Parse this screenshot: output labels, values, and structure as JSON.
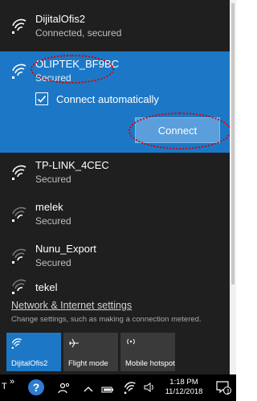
{
  "networks": [
    {
      "name": "DijitalOfis2",
      "status": "Connected, secured"
    },
    {
      "name": "OLIPTEK_BF9BC",
      "status": "Secured"
    },
    {
      "name": "TP-LINK_4CEC",
      "status": "Secured"
    },
    {
      "name": "melek",
      "status": "Secured"
    },
    {
      "name": "Nunu_Export",
      "status": "Secured"
    },
    {
      "name": "tekel",
      "status": ""
    }
  ],
  "selected": {
    "connect_automatically_label": "Connect automatically",
    "connect_automatically_checked": true,
    "connect_button_label": "Connect"
  },
  "settings": {
    "link_label": "Network & Internet settings",
    "description": "Change settings, such as making a connection metered."
  },
  "quick_actions": [
    {
      "label": "DijitalOfis2",
      "icon": "wifi-icon",
      "active": true
    },
    {
      "label": "Flight mode",
      "icon": "airplane-icon",
      "active": false
    },
    {
      "label": "Mobile hotspot",
      "icon": "hotspot-icon",
      "active": false
    }
  ],
  "taskbar": {
    "left_glyph": "T",
    "chevron_glyph": "»",
    "time": "1:18 PM",
    "date": "11/12/2018",
    "notification_count": "1"
  },
  "colors": {
    "flyout_bg": "#1f1f1f",
    "accent": "#1c78c6",
    "annotation": "#d50000"
  }
}
